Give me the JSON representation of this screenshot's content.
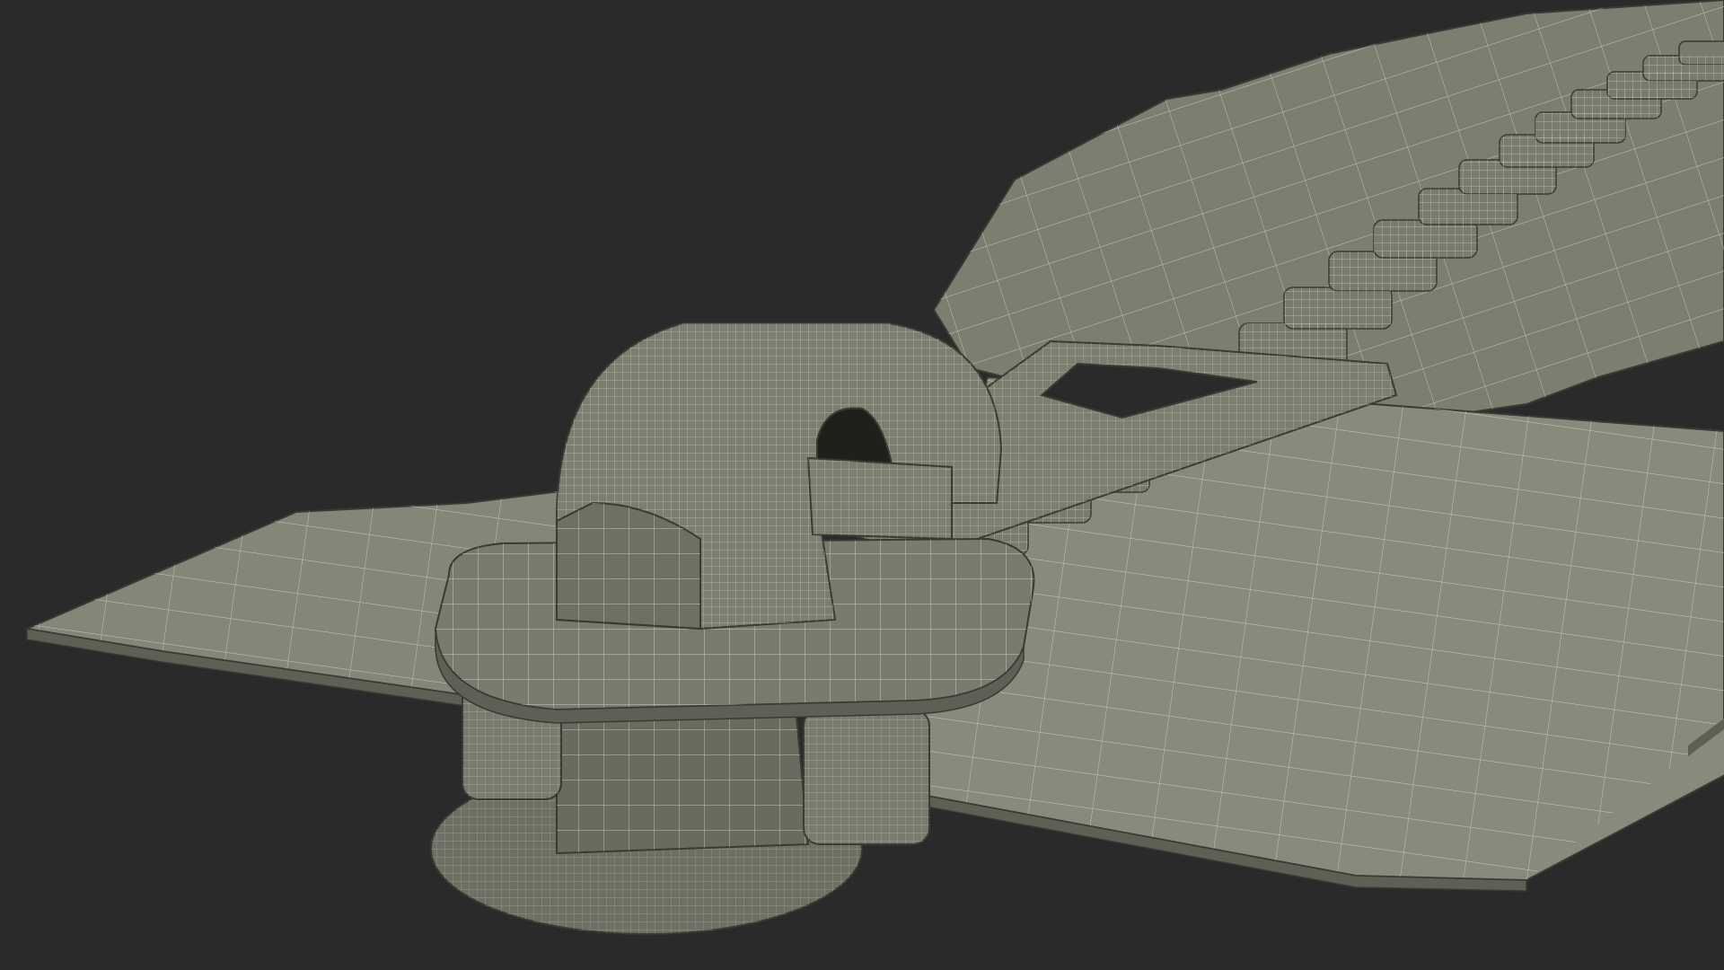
{
  "scene": {
    "subject": "zipper-slider-wireframe-render",
    "background_color": "#2a2a2a",
    "surface_color": "#7d7d70",
    "surface_light_color": "#8a8a7c",
    "surface_dark_color": "#5f5f55",
    "wire_color": "#e6e6da",
    "edge_color": "#3a3a34"
  }
}
